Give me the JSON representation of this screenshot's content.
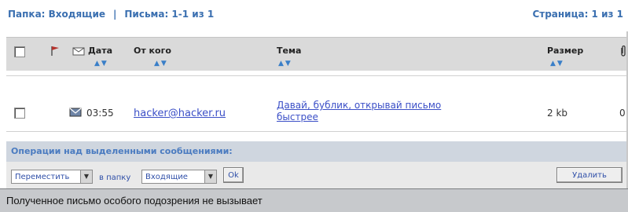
{
  "top": {
    "folder": "Папка: Входящие",
    "separator": "|",
    "letters": "Письма: 1-1 из 1",
    "page": "Страница: 1 из 1"
  },
  "table": {
    "headers": {
      "date": "Дата",
      "from": "От кого",
      "subject": "Тема",
      "size": "Размер"
    },
    "sort_arrows": "▲▼",
    "row": {
      "time": "03:55",
      "from": "hacker@hacker.ru",
      "subject_line1": "Давай, бублик, открывай письмо",
      "subject_line2": "быстрее",
      "size": "2 kb",
      "attachments": "0"
    }
  },
  "operations": {
    "title": "Операции над выделенными сообщениями:",
    "move_select": "Переместить",
    "to_folder_label": "в папку",
    "folder_select": "Входящие",
    "ok_button": "Ok",
    "delete_button": "Удалить"
  },
  "caption": "Полученное письмо особого подозрения не вызывает"
}
